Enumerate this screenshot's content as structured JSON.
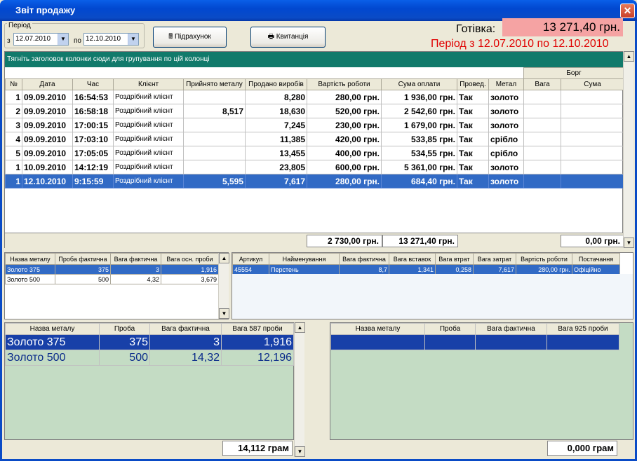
{
  "window": {
    "title": "Звіт продажу",
    "close_glyph": "✕"
  },
  "period": {
    "label": "Період",
    "from_label": "з",
    "from_value": "12.07.2010",
    "to_label": "по",
    "to_value": "12.10.2010"
  },
  "buttons": {
    "calc": "Підрахунок",
    "receipt": "Квитанція"
  },
  "cash": {
    "label": "Готівка:",
    "value": "13 271,40 грн."
  },
  "period_banner": "Період з 12.07.2010 по 12.10.2010",
  "main_grid": {
    "group_hint": "Тягніть заголовок колонки сюди для групування по цій колонці",
    "debt_header": "Борг",
    "columns": [
      "№",
      "Дата",
      "Час",
      "Клієнт",
      "Прийнято металу",
      "Продано виробів",
      "Вартість роботи",
      "Сума оплати",
      "Провед.",
      "Метал",
      "Вага",
      "Сума"
    ],
    "rows": [
      {
        "n": "1",
        "date": "09.09.2010",
        "time": "16:54:53",
        "client": "Роздрібний клієнт",
        "metal_in": "",
        "sold": "8,280",
        "work": "280,00 грн.",
        "paid": "1 936,00 грн.",
        "posted": "Так",
        "metal": "золото",
        "w": "",
        "s": ""
      },
      {
        "n": "2",
        "date": "09.09.2010",
        "time": "16:58:18",
        "client": "Роздрібний клієнт",
        "metal_in": "8,517",
        "sold": "18,630",
        "work": "520,00 грн.",
        "paid": "2 542,60 грн.",
        "posted": "Так",
        "metal": "золото",
        "w": "",
        "s": ""
      },
      {
        "n": "3",
        "date": "09.09.2010",
        "time": "17:00:15",
        "client": "Роздрібний клієнт",
        "metal_in": "",
        "sold": "7,245",
        "work": "230,00 грн.",
        "paid": "1 679,00 грн.",
        "posted": "Так",
        "metal": "золото",
        "w": "",
        "s": ""
      },
      {
        "n": "4",
        "date": "09.09.2010",
        "time": "17:03:10",
        "client": "Роздрібний клієнт",
        "metal_in": "",
        "sold": "11,385",
        "work": "420,00 грн.",
        "paid": "533,85 грн.",
        "posted": "Так",
        "metal": "срібло",
        "w": "",
        "s": ""
      },
      {
        "n": "5",
        "date": "09.09.2010",
        "time": "17:05:05",
        "client": "Роздрібний клієнт",
        "metal_in": "",
        "sold": "13,455",
        "work": "400,00 грн.",
        "paid": "534,55 грн.",
        "posted": "Так",
        "metal": "срібло",
        "w": "",
        "s": ""
      },
      {
        "n": "1",
        "date": "10.09.2010",
        "time": "14:12:19",
        "client": "Роздрібний клієнт",
        "metal_in": "",
        "sold": "23,805",
        "work": "600,00 грн.",
        "paid": "5 361,00 грн.",
        "posted": "Так",
        "metal": "золото",
        "w": "",
        "s": ""
      },
      {
        "n": "1",
        "date": "12.10.2010",
        "time": "9:15:59",
        "client": "Роздрібний клієнт",
        "metal_in": "5,595",
        "sold": "7,617",
        "work": "280,00 грн.",
        "paid": "684,40 грн.",
        "posted": "Так",
        "metal": "золото",
        "w": "",
        "s": ""
      }
    ],
    "totals": {
      "work": "2 730,00 грн.",
      "paid": "13 271,40 грн.",
      "debt": "0,00 грн."
    }
  },
  "metal_small": {
    "columns": [
      "Назва металу",
      "Проба фактична",
      "Вага фактична",
      "Вага осн. проби"
    ],
    "rows": [
      [
        "Золото 375",
        "375",
        "3",
        "1,916"
      ],
      [
        "Золото 500",
        "500",
        "4,32",
        "3,679"
      ]
    ]
  },
  "items": {
    "columns": [
      "Артикул",
      "Найменування",
      "Вага фактична",
      "Вага вставок",
      "Вага втрат",
      "Вага затрат",
      "Вартість роботи",
      "Постачання"
    ],
    "rows": [
      [
        "45554",
        "Перстень",
        "8,7",
        "1,341",
        "0,258",
        "7,617",
        "280,00 грн.",
        "Офіційно"
      ]
    ]
  },
  "gold_summary": {
    "columns": [
      "Назва металу",
      "Проба",
      "Вага фактична",
      "Вага 587 проби"
    ],
    "rows": [
      [
        "Золото 375",
        "375",
        "3",
        "1,916"
      ],
      [
        "Золото 500",
        "500",
        "14,32",
        "12,196"
      ]
    ],
    "total": "14,112 грам"
  },
  "silver_summary": {
    "columns": [
      "Назва металу",
      "Проба",
      "Вага фактична",
      "Вага 925 проби"
    ],
    "rows": [],
    "total": "0,000 грам"
  }
}
